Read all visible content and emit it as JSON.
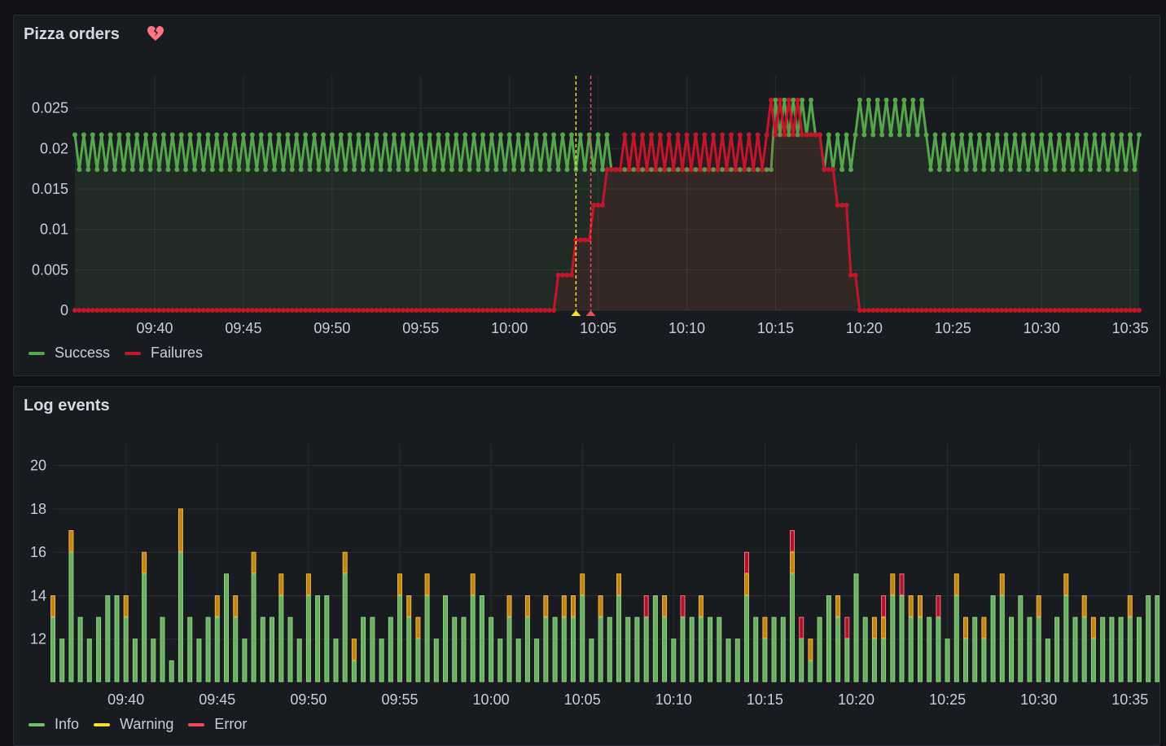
{
  "panels": [
    {
      "title": "Pizza orders",
      "alert_state": "broken-heart-icon",
      "legend": [
        {
          "label": "Success",
          "color": "#56a64b"
        },
        {
          "label": "Failures",
          "color": "#c4162a"
        }
      ]
    },
    {
      "title": "Log events",
      "legend": [
        {
          "label": "Info",
          "color": "#73bf69"
        },
        {
          "label": "Warning",
          "color": "#fade2a"
        },
        {
          "label": "Error",
          "color": "#f2495c"
        }
      ]
    }
  ],
  "chart_data": [
    {
      "type": "line",
      "title": "Pizza orders",
      "x_ticks": [
        "09:40",
        "09:45",
        "09:50",
        "09:55",
        "10:00",
        "10:05",
        "10:10",
        "10:15",
        "10:20",
        "10:25",
        "10:30",
        "10:35"
      ],
      "y_ticks": [
        "0",
        "0.005",
        "0.01",
        "0.015",
        "0.02",
        "0.025"
      ],
      "ylim": [
        0,
        0.029
      ],
      "x_range": [
        "09:35:30",
        "10:35:30"
      ],
      "grid": true,
      "legend_position": "bottom-left",
      "point_interval_seconds": 15,
      "series": [
        {
          "name": "Success",
          "color": "#56a64b",
          "segments": [
            {
              "from": "09:35:30",
              "to": "10:05:45",
              "pattern": "alternate",
              "values": [
                0.0217,
                0.0174
              ]
            },
            {
              "from": "10:05:45",
              "to": "10:15:00",
              "pattern": "constant",
              "values": [
                0.0174
              ]
            },
            {
              "from": "10:15:00",
              "to": "10:17:30",
              "pattern": "alternate",
              "values": [
                0.026,
                0.0217
              ]
            },
            {
              "from": "10:17:30",
              "to": "10:19:45",
              "pattern": "alternate",
              "values": [
                0.0217,
                0.0174
              ]
            },
            {
              "from": "10:19:45",
              "to": "10:23:30",
              "pattern": "alternate",
              "values": [
                0.026,
                0.0217
              ]
            },
            {
              "from": "10:23:30",
              "to": "10:35:30",
              "pattern": "alternate",
              "values": [
                0.0217,
                0.0174
              ]
            }
          ]
        },
        {
          "name": "Failures",
          "color": "#c4162a",
          "steps": [
            {
              "from": "09:35:30",
              "value": 0
            },
            {
              "from": "10:02:45",
              "value": 0.00435
            },
            {
              "from": "10:03:45",
              "value": 0.0087
            },
            {
              "from": "10:04:45",
              "value": 0.013
            },
            {
              "from": "10:05:30",
              "value": 0.0174
            },
            {
              "from": "10:06:30",
              "pattern": "alternate",
              "values": [
                0.0217,
                0.0174
              ]
            },
            {
              "from": "10:14:45",
              "pattern": "alternate",
              "values": [
                0.026,
                0.0217
              ]
            },
            {
              "from": "10:16:45",
              "value": 0.0217
            },
            {
              "from": "10:17:45",
              "value": 0.0174
            },
            {
              "from": "10:18:30",
              "value": 0.013
            },
            {
              "from": "10:19:15",
              "value": 0.00435
            },
            {
              "from": "10:19:45",
              "value": 0
            }
          ]
        }
      ],
      "annotations": [
        {
          "time": "10:03:45",
          "color": "#fade2a"
        },
        {
          "time": "10:04:35",
          "color": "#f2495c"
        }
      ]
    },
    {
      "type": "bar",
      "stacked": true,
      "title": "Log events",
      "x_ticks": [
        "09:40",
        "09:45",
        "09:50",
        "09:55",
        "10:00",
        "10:05",
        "10:10",
        "10:15",
        "10:20",
        "10:25",
        "10:30",
        "10:35"
      ],
      "y_ticks": [
        "12",
        "14",
        "16",
        "18",
        "20"
      ],
      "ylim": [
        10,
        21
      ],
      "x_range": [
        "09:36:00",
        "10:35:30"
      ],
      "grid": true,
      "legend_position": "bottom-left",
      "bar_interval_seconds": 30,
      "series": [
        {
          "name": "Info",
          "color": "#73bf69",
          "values": [
            13,
            12,
            16,
            13,
            12,
            13,
            14,
            14,
            13,
            12,
            15,
            12,
            13,
            11,
            16,
            13,
            12,
            13,
            13,
            15,
            13,
            12,
            15,
            13,
            13,
            14,
            13,
            12,
            14,
            14,
            14,
            12,
            15,
            11,
            13,
            13,
            12,
            13,
            14,
            13,
            12,
            14,
            12,
            14,
            13,
            13,
            14,
            14,
            13,
            12,
            13,
            12,
            13,
            12,
            13,
            13,
            13,
            13,
            14,
            12,
            13,
            13,
            14,
            13,
            13,
            13,
            14,
            13,
            12,
            13,
            13,
            13,
            13,
            13,
            12,
            12,
            14,
            13,
            12,
            13,
            13,
            15,
            12,
            11,
            13,
            14,
            13,
            12,
            15,
            13,
            12,
            12,
            14,
            14,
            13,
            13,
            13,
            13,
            12,
            14,
            12,
            13,
            12,
            14,
            14,
            13,
            14,
            13,
            13,
            12,
            13,
            14,
            13,
            13,
            12,
            13,
            13,
            13,
            13,
            13,
            14,
            14,
            12,
            16,
            14,
            13
          ]
        },
        {
          "name": "Warning",
          "color": "#fade2a",
          "values": [
            1,
            0,
            1,
            0,
            0,
            0,
            0,
            0,
            1,
            0,
            1,
            0,
            0,
            0,
            2,
            0,
            0,
            0,
            1,
            0,
            1,
            0,
            1,
            0,
            0,
            1,
            0,
            0,
            1,
            0,
            0,
            0,
            1,
            1,
            0,
            0,
            0,
            0,
            1,
            1,
            1,
            1,
            0,
            0,
            0,
            0,
            1,
            0,
            0,
            0,
            1,
            0,
            1,
            0,
            1,
            0,
            1,
            1,
            1,
            0,
            1,
            0,
            1,
            0,
            0,
            0,
            0,
            1,
            0,
            0,
            0,
            1,
            0,
            0,
            0,
            0,
            1,
            0,
            1,
            0,
            0,
            1,
            0,
            1,
            0,
            0,
            1,
            0,
            0,
            0,
            1,
            1,
            1,
            0,
            1,
            1,
            0,
            0,
            0,
            1,
            1,
            0,
            1,
            0,
            1,
            0,
            0,
            0,
            1,
            0,
            0,
            1,
            0,
            1,
            1,
            0,
            0,
            0,
            1,
            0,
            0,
            0,
            0,
            2,
            0,
            1
          ]
        },
        {
          "name": "Error",
          "color": "#f2495c",
          "values": [
            0,
            0,
            0,
            0,
            0,
            0,
            0,
            0,
            0,
            0,
            0,
            0,
            0,
            0,
            0,
            0,
            0,
            0,
            0,
            0,
            0,
            0,
            0,
            0,
            0,
            0,
            0,
            0,
            0,
            0,
            0,
            0,
            0,
            0,
            0,
            0,
            0,
            0,
            0,
            0,
            0,
            0,
            0,
            0,
            0,
            0,
            0,
            0,
            0,
            0,
            0,
            0,
            0,
            0,
            0,
            0,
            0,
            0,
            0,
            0,
            0,
            0,
            0,
            0,
            0,
            1,
            0,
            0,
            0,
            1,
            0,
            0,
            0,
            0,
            0,
            0,
            1,
            0,
            0,
            0,
            0,
            1,
            1,
            0,
            0,
            0,
            0,
            1,
            0,
            0,
            0,
            1,
            0,
            1,
            0,
            0,
            0,
            1,
            0,
            0,
            0,
            0,
            0,
            0,
            0,
            0,
            0,
            0,
            0,
            0,
            0,
            0,
            0,
            0,
            0,
            0,
            0,
            0,
            0,
            0,
            0,
            0,
            0,
            0,
            0,
            0
          ]
        }
      ]
    }
  ]
}
